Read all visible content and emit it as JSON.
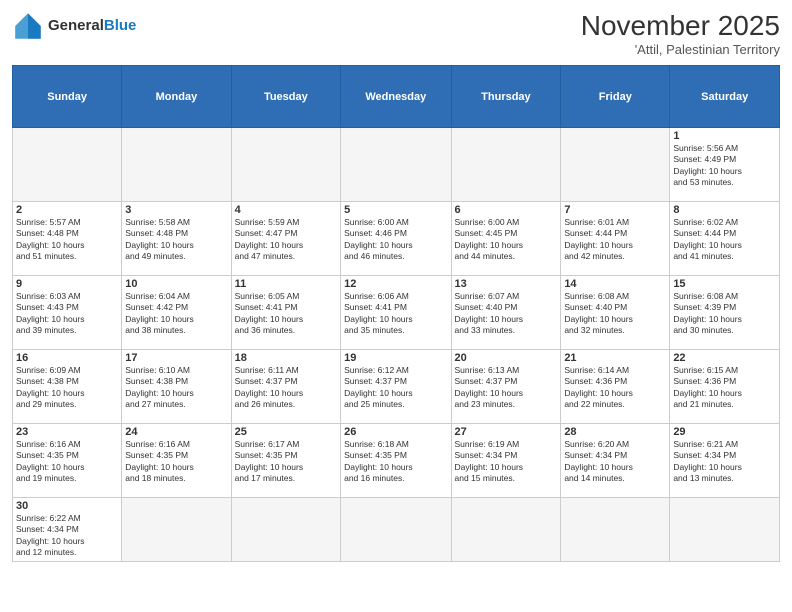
{
  "header": {
    "logo_general": "General",
    "logo_blue": "Blue",
    "month_title": "November 2025",
    "location": "'Attil, Palestinian Territory"
  },
  "days_of_week": [
    "Sunday",
    "Monday",
    "Tuesday",
    "Wednesday",
    "Thursday",
    "Friday",
    "Saturday"
  ],
  "weeks": [
    [
      {
        "day": "",
        "info": ""
      },
      {
        "day": "",
        "info": ""
      },
      {
        "day": "",
        "info": ""
      },
      {
        "day": "",
        "info": ""
      },
      {
        "day": "",
        "info": ""
      },
      {
        "day": "",
        "info": ""
      },
      {
        "day": "1",
        "info": "Sunrise: 5:56 AM\nSunset: 4:49 PM\nDaylight: 10 hours\nand 53 minutes."
      }
    ],
    [
      {
        "day": "2",
        "info": "Sunrise: 5:57 AM\nSunset: 4:48 PM\nDaylight: 10 hours\nand 51 minutes."
      },
      {
        "day": "3",
        "info": "Sunrise: 5:58 AM\nSunset: 4:48 PM\nDaylight: 10 hours\nand 49 minutes."
      },
      {
        "day": "4",
        "info": "Sunrise: 5:59 AM\nSunset: 4:47 PM\nDaylight: 10 hours\nand 47 minutes."
      },
      {
        "day": "5",
        "info": "Sunrise: 6:00 AM\nSunset: 4:46 PM\nDaylight: 10 hours\nand 46 minutes."
      },
      {
        "day": "6",
        "info": "Sunrise: 6:00 AM\nSunset: 4:45 PM\nDaylight: 10 hours\nand 44 minutes."
      },
      {
        "day": "7",
        "info": "Sunrise: 6:01 AM\nSunset: 4:44 PM\nDaylight: 10 hours\nand 42 minutes."
      },
      {
        "day": "8",
        "info": "Sunrise: 6:02 AM\nSunset: 4:44 PM\nDaylight: 10 hours\nand 41 minutes."
      }
    ],
    [
      {
        "day": "9",
        "info": "Sunrise: 6:03 AM\nSunset: 4:43 PM\nDaylight: 10 hours\nand 39 minutes."
      },
      {
        "day": "10",
        "info": "Sunrise: 6:04 AM\nSunset: 4:42 PM\nDaylight: 10 hours\nand 38 minutes."
      },
      {
        "day": "11",
        "info": "Sunrise: 6:05 AM\nSunset: 4:41 PM\nDaylight: 10 hours\nand 36 minutes."
      },
      {
        "day": "12",
        "info": "Sunrise: 6:06 AM\nSunset: 4:41 PM\nDaylight: 10 hours\nand 35 minutes."
      },
      {
        "day": "13",
        "info": "Sunrise: 6:07 AM\nSunset: 4:40 PM\nDaylight: 10 hours\nand 33 minutes."
      },
      {
        "day": "14",
        "info": "Sunrise: 6:08 AM\nSunset: 4:40 PM\nDaylight: 10 hours\nand 32 minutes."
      },
      {
        "day": "15",
        "info": "Sunrise: 6:08 AM\nSunset: 4:39 PM\nDaylight: 10 hours\nand 30 minutes."
      }
    ],
    [
      {
        "day": "16",
        "info": "Sunrise: 6:09 AM\nSunset: 4:38 PM\nDaylight: 10 hours\nand 29 minutes."
      },
      {
        "day": "17",
        "info": "Sunrise: 6:10 AM\nSunset: 4:38 PM\nDaylight: 10 hours\nand 27 minutes."
      },
      {
        "day": "18",
        "info": "Sunrise: 6:11 AM\nSunset: 4:37 PM\nDaylight: 10 hours\nand 26 minutes."
      },
      {
        "day": "19",
        "info": "Sunrise: 6:12 AM\nSunset: 4:37 PM\nDaylight: 10 hours\nand 25 minutes."
      },
      {
        "day": "20",
        "info": "Sunrise: 6:13 AM\nSunset: 4:37 PM\nDaylight: 10 hours\nand 23 minutes."
      },
      {
        "day": "21",
        "info": "Sunrise: 6:14 AM\nSunset: 4:36 PM\nDaylight: 10 hours\nand 22 minutes."
      },
      {
        "day": "22",
        "info": "Sunrise: 6:15 AM\nSunset: 4:36 PM\nDaylight: 10 hours\nand 21 minutes."
      }
    ],
    [
      {
        "day": "23",
        "info": "Sunrise: 6:16 AM\nSunset: 4:35 PM\nDaylight: 10 hours\nand 19 minutes."
      },
      {
        "day": "24",
        "info": "Sunrise: 6:16 AM\nSunset: 4:35 PM\nDaylight: 10 hours\nand 18 minutes."
      },
      {
        "day": "25",
        "info": "Sunrise: 6:17 AM\nSunset: 4:35 PM\nDaylight: 10 hours\nand 17 minutes."
      },
      {
        "day": "26",
        "info": "Sunrise: 6:18 AM\nSunset: 4:35 PM\nDaylight: 10 hours\nand 16 minutes."
      },
      {
        "day": "27",
        "info": "Sunrise: 6:19 AM\nSunset: 4:34 PM\nDaylight: 10 hours\nand 15 minutes."
      },
      {
        "day": "28",
        "info": "Sunrise: 6:20 AM\nSunset: 4:34 PM\nDaylight: 10 hours\nand 14 minutes."
      },
      {
        "day": "29",
        "info": "Sunrise: 6:21 AM\nSunset: 4:34 PM\nDaylight: 10 hours\nand 13 minutes."
      }
    ],
    [
      {
        "day": "30",
        "info": "Sunrise: 6:22 AM\nSunset: 4:34 PM\nDaylight: 10 hours\nand 12 minutes."
      },
      {
        "day": "",
        "info": ""
      },
      {
        "day": "",
        "info": ""
      },
      {
        "day": "",
        "info": ""
      },
      {
        "day": "",
        "info": ""
      },
      {
        "day": "",
        "info": ""
      },
      {
        "day": "",
        "info": ""
      }
    ]
  ]
}
